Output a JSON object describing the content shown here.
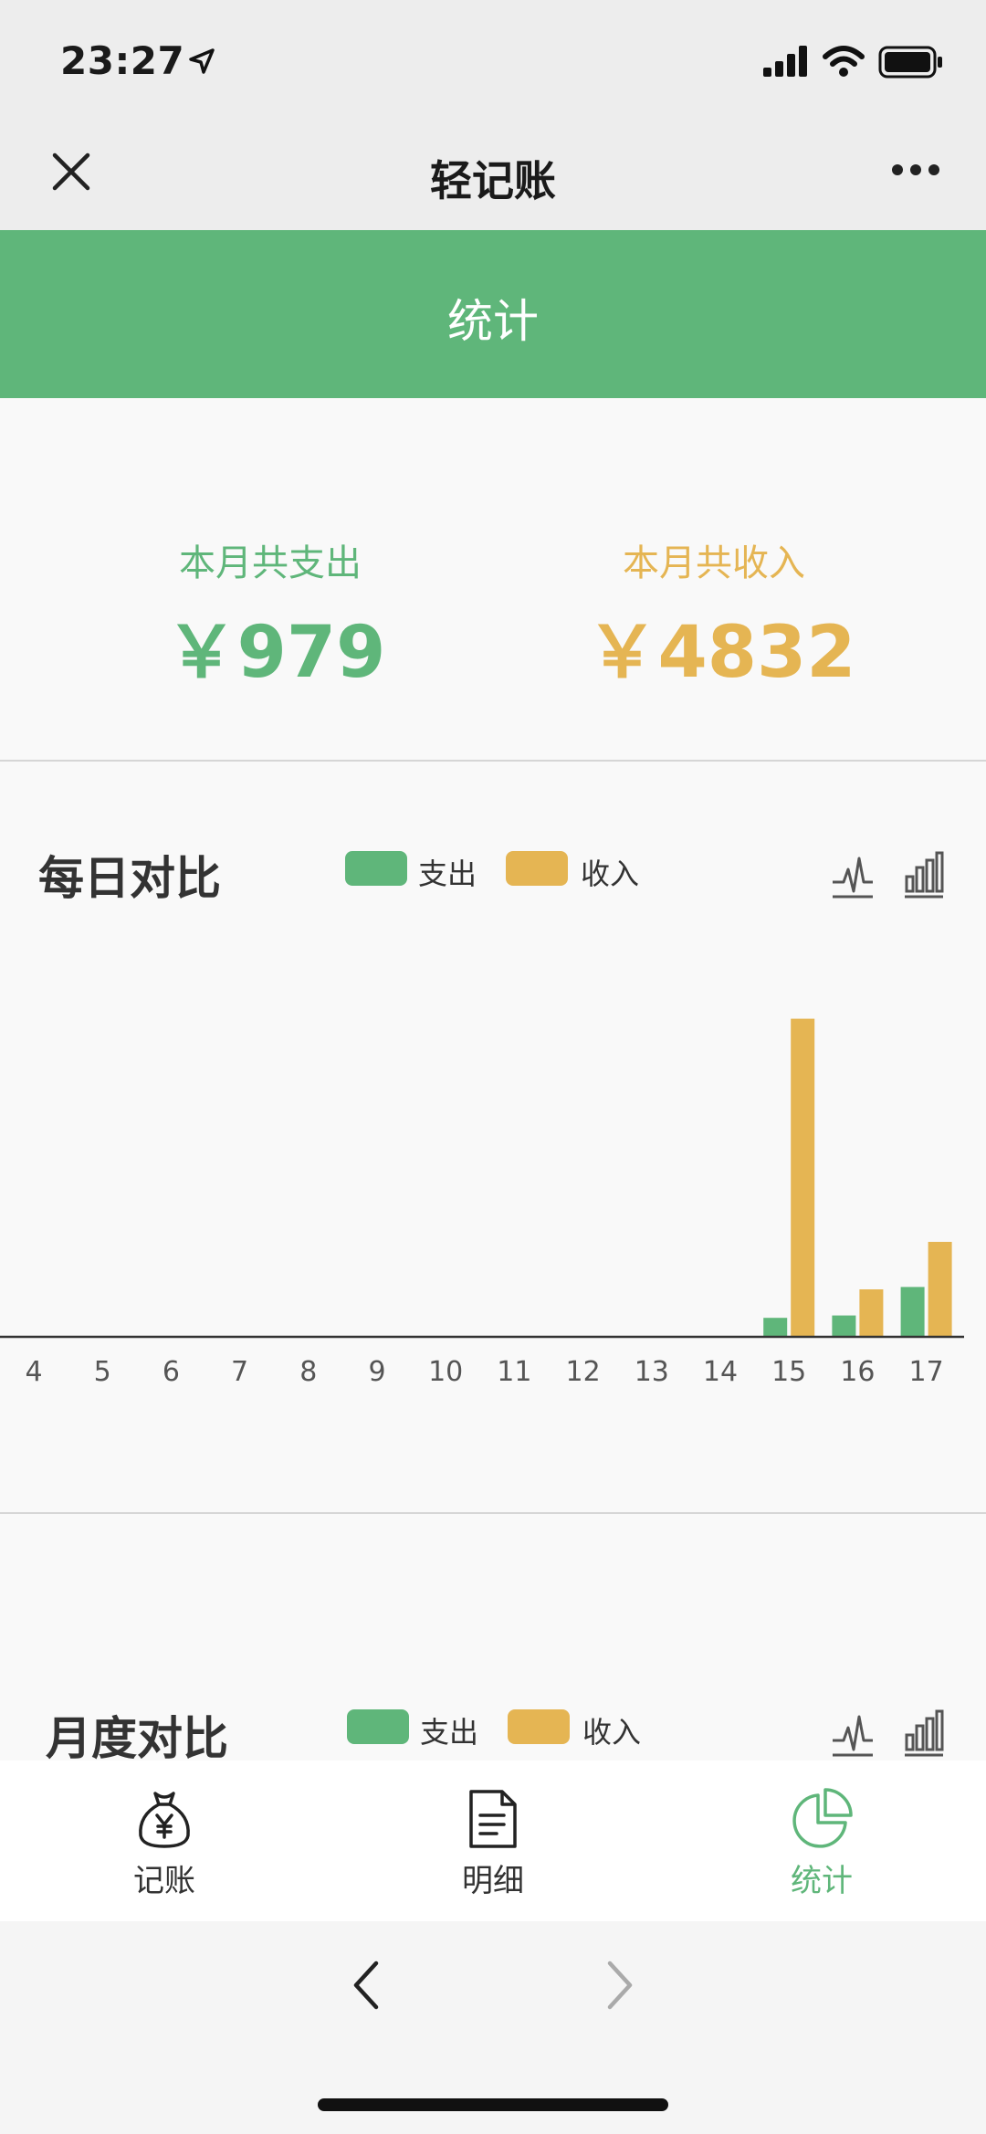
{
  "status": {
    "time": "23:27"
  },
  "nav": {
    "title": "轻记账"
  },
  "header": {
    "title": "统计"
  },
  "summary": {
    "expense_label": "本月共支出",
    "expense_value": "￥979",
    "income_label": "本月共收入",
    "income_value": "￥4832"
  },
  "daily": {
    "title": "每日对比",
    "legend": {
      "expense": "支出",
      "income": "收入"
    }
  },
  "monthly": {
    "title": "月度对比",
    "legend": {
      "expense": "支出",
      "income": "收入"
    }
  },
  "tabs": [
    {
      "label": "记账",
      "icon": "money-bag-icon"
    },
    {
      "label": "明细",
      "icon": "document-icon"
    },
    {
      "label": "统计",
      "icon": "pie-chart-icon"
    }
  ],
  "colors": {
    "expense": "#5fb67a",
    "income": "#e5b553",
    "header": "#5fb67a",
    "active_tab": "#5fb67a"
  },
  "chart_data": {
    "type": "bar",
    "categories": [
      "4",
      "5",
      "6",
      "7",
      "8",
      "9",
      "10",
      "11",
      "12",
      "13",
      "14",
      "15",
      "16",
      "17"
    ],
    "series": [
      {
        "name": "支出",
        "values": [
          0,
          0,
          0,
          0,
          0,
          0,
          0,
          0,
          0,
          0,
          0,
          40,
          45,
          105
        ]
      },
      {
        "name": "收入",
        "values": [
          0,
          0,
          0,
          0,
          0,
          0,
          0,
          0,
          0,
          0,
          0,
          670,
          100,
          200
        ]
      }
    ],
    "ylim": [
      0,
      700
    ],
    "grid": false,
    "legend": "top"
  }
}
